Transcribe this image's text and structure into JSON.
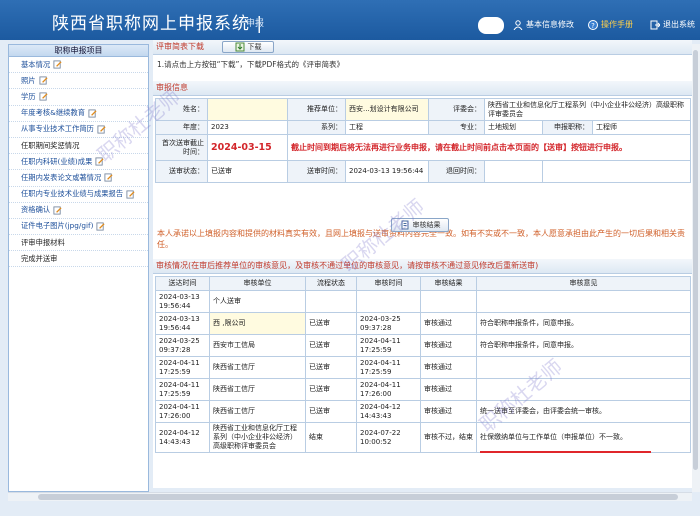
{
  "header": {
    "title": "陕西省职称网上申报系统 |",
    "subtitle": "申报",
    "profile_label": "基本信息修改",
    "manual_label": "操作手册",
    "logout_label": "退出系统",
    "manual_color": "#ffd04a"
  },
  "sidebar": {
    "title": "职称申报项目",
    "items": [
      {
        "label": "基本情况",
        "edit": true
      },
      {
        "label": "照片",
        "edit": true
      },
      {
        "label": "学历",
        "edit": true
      },
      {
        "label": "年度考核&继续教育",
        "edit": true
      },
      {
        "label": "从事专业技术工作简历",
        "edit": true
      },
      {
        "label": "任职期间奖惩情况",
        "edit": false
      },
      {
        "label": "任职内科研(业绩)成果",
        "edit": true
      },
      {
        "label": "任期内发表论文或著情况",
        "edit": true
      },
      {
        "label": "任职内专业技术业绩与成果报告",
        "edit": true
      },
      {
        "label": "资格确认",
        "edit": true
      },
      {
        "label": "证件电子图片(jpg/gif)",
        "edit": true
      },
      {
        "label": "评审申报材料",
        "edit": false
      },
      {
        "label": "完成并送审",
        "edit": false
      }
    ]
  },
  "review_table_section": {
    "title": "评审简表下载",
    "download_label": "下载",
    "instruction": "1.请点击上方按钮“下载”，下载PDF格式的《评审简表》"
  },
  "review_info": {
    "title": "审报信息",
    "name_label": "姓名：",
    "name_value": "",
    "unit_label": "推荐单位：",
    "unit_value": "西安...划设计有限公司",
    "committee_label": "评委会：",
    "committee_value": "陕西省工业和信息化厅工程系列（中小企业非公经济）高级职称评审委员会",
    "year_label": "年度：",
    "year_value": "2023",
    "series_label": "系列：",
    "series_value": "工程",
    "major_label": "专业：",
    "major_value": "土地规划",
    "title_label": "申报职称：",
    "title_value": "工程师",
    "deadline_label": "首次送审截止时间：",
    "deadline_value": "2024-03-15",
    "deadline_warning": "截止时间到期后将无法再进行业务申报，请在截止时间前点击本页面的【送审】按钮进行申报。",
    "status_label": "送审状态：",
    "status_value": "已送审",
    "time_label": "送审时间：",
    "time_value": "2024-03-13 19:56:44",
    "return_label": "退回时间：",
    "return_value": "",
    "pledge": "本人承诺以上填报内容和提供的材料真实有效，且网上填报与送审资料内容完全一致。如有不实或不一致，本人愿意承担由此产生的一切后果和相关责任。",
    "result_button": "审核结果"
  },
  "audit": {
    "title": "审核情况(在审后推荐单位的审核意见，及审核不通过单位的审核意见，请按审核不通过意见修改后重新送审)",
    "headers": [
      "送达时间",
      "审核单位",
      "流程状态",
      "审核时间",
      "审核结果",
      "审核意见"
    ],
    "rows": [
      [
        "2024-03-13 19:56:44",
        "个人送审",
        "",
        "",
        "",
        ""
      ],
      [
        "2024-03-13 19:56:44",
        "西 ,限公司",
        "已送审",
        "2024-03-25 09:37:28",
        "审核通过",
        "符合职称申报条件，同意申报。"
      ],
      [
        "2024-03-25 09:37:28",
        "西安市工信局",
        "已送审",
        "2024-04-11 17:25:59",
        "审核通过",
        "符合职称申报条件，同意申报。"
      ],
      [
        "2024-04-11 17:25:59",
        "陕西省工信厅",
        "已送审",
        "2024-04-11 17:25:59",
        "审核通过",
        ""
      ],
      [
        "2024-04-11 17:25:59",
        "陕西省工信厅",
        "已送审",
        "2024-04-11 17:26:00",
        "审核通过",
        ""
      ],
      [
        "2024-04-11 17:26:00",
        "陕西省工信厅",
        "已送审",
        "2024-04-12 14:43:43",
        "审核通过",
        "统一送审至评委会，由评委会统一审核。"
      ],
      [
        "2024-04-12 14:43:43",
        "陕西省工业和信息化厅工程系列（中小企业非公经济）高级职称评审委员会",
        "结束",
        "2024-07-22 10:00:52",
        "审核不过，结束",
        "社保缴纳单位与工作单位（申报单位）不一致。"
      ]
    ]
  },
  "watermark": "职称杜老师"
}
